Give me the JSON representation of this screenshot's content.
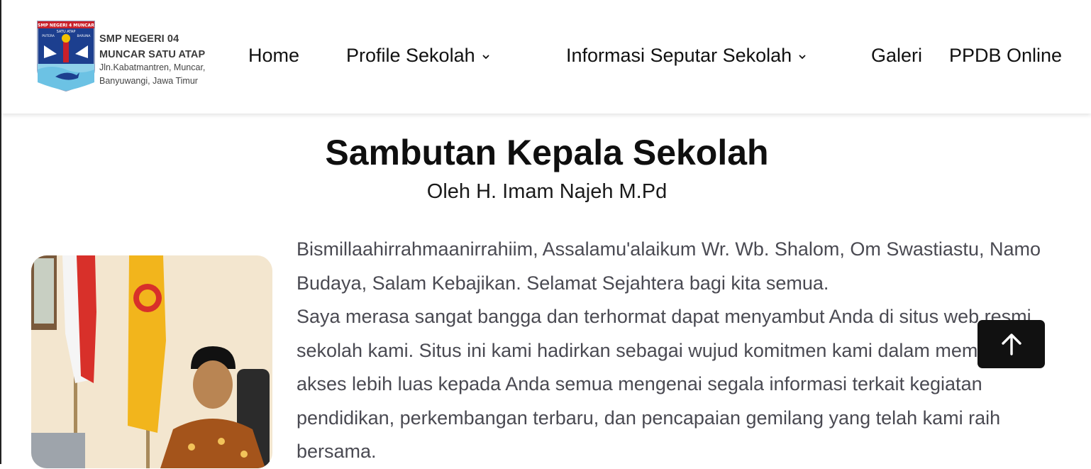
{
  "header": {
    "logo": {
      "badge_top_text": "SMP NEGERI 4 MUNCAR",
      "badge_sub_text": "SATU ATAP",
      "badge_left_word": "PUTERA",
      "badge_right_word": "BARUNA"
    },
    "school_name_line1": "SMP NEGERI 04",
    "school_name_line2": "MUNCAR SATU ATAP",
    "address_line1": "Jln.Kabatmantren, Muncar,",
    "address_line2": "Banyuwangi, Jawa Timur"
  },
  "nav": {
    "items": [
      {
        "label": "Home",
        "icon": null
      },
      {
        "label": "Profile Sekolah",
        "icon": "chevron-down-icon"
      },
      {
        "label": "Informasi Seputar Sekolah",
        "icon": "chevron-down-icon"
      },
      {
        "label": "Galeri",
        "icon": null
      },
      {
        "label": "PPDB Online",
        "icon": null
      }
    ]
  },
  "main": {
    "title": "Sambutan Kepala Sekolah",
    "subtitle": "Oleh H. Imam Najeh M.Pd",
    "paragraph1": "Bismillaahirrahmaanirrahiim, Assalamu'alaikum Wr. Wb. Shalom, Om Swastiastu, Namo Budaya, Salam Kebajikan. Selamat Sejahtera bagi kita semua.",
    "paragraph2": "Saya merasa sangat bangga dan terhormat dapat menyambut Anda di situs web resmi sekolah kami. Situs ini kami hadirkan sebagai wujud komitmen kami dalam memberikan akses lebih luas kepada Anda semua mengenai segala informasi terkait kegiatan pendidikan, perkembangan terbaru, dan pencapaian gemilang yang telah kami raih bersama."
  },
  "scroll_top": {
    "icon": "arrow-up-icon"
  },
  "colors": {
    "nav_text": "#111111",
    "body_text": "#4a4a52",
    "scroll_button_bg": "#111111"
  }
}
